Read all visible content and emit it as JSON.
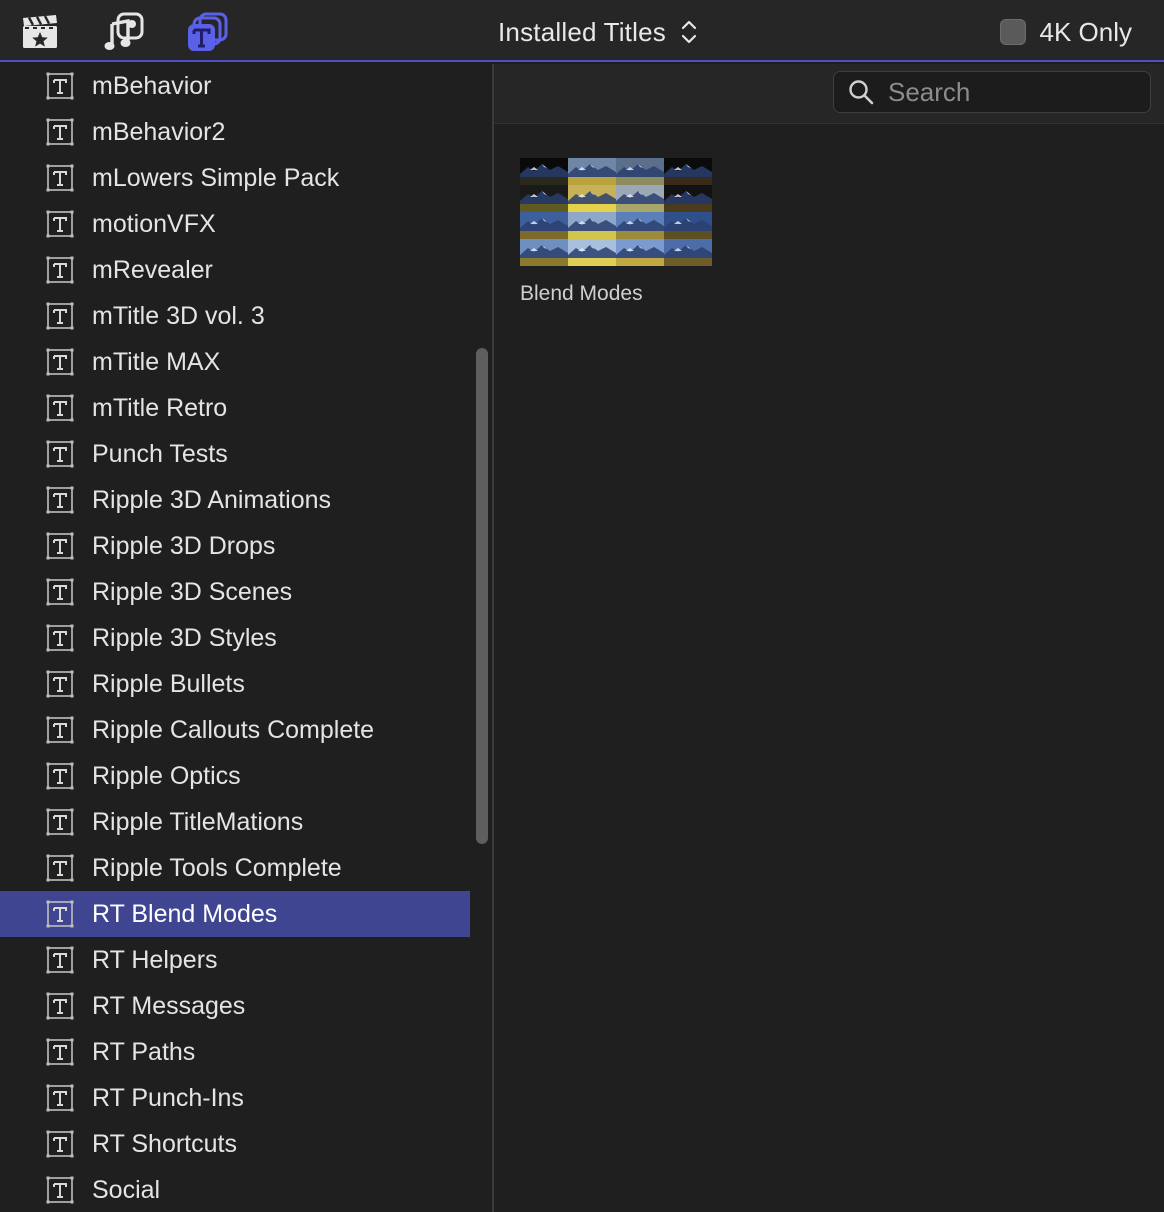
{
  "toolbar": {
    "icons": [
      "clapboard-star-icon",
      "music-photo-icon",
      "titles-icon"
    ],
    "browser_title": "Installed Titles",
    "filter_label": "4K Only",
    "filter_checked": false
  },
  "sidebar": {
    "items": [
      {
        "label": "mBehavior"
      },
      {
        "label": "mBehavior2"
      },
      {
        "label": "mLowers Simple Pack"
      },
      {
        "label": "motionVFX"
      },
      {
        "label": "mRevealer"
      },
      {
        "label": "mTitle 3D vol. 3"
      },
      {
        "label": "mTitle MAX"
      },
      {
        "label": "mTitle Retro"
      },
      {
        "label": "Punch Tests"
      },
      {
        "label": "Ripple 3D Animations"
      },
      {
        "label": "Ripple 3D Drops"
      },
      {
        "label": "Ripple 3D Scenes"
      },
      {
        "label": "Ripple 3D Styles"
      },
      {
        "label": "Ripple Bullets"
      },
      {
        "label": "Ripple Callouts Complete"
      },
      {
        "label": "Ripple Optics"
      },
      {
        "label": "Ripple TitleMations"
      },
      {
        "label": "Ripple Tools Complete"
      },
      {
        "label": "RT Blend Modes",
        "selected": true
      },
      {
        "label": "RT Helpers"
      },
      {
        "label": "RT Messages"
      },
      {
        "label": "RT Paths"
      },
      {
        "label": "RT Punch-Ins"
      },
      {
        "label": "RT Shortcuts"
      },
      {
        "label": "Social"
      }
    ]
  },
  "search": {
    "placeholder": "Search",
    "value": ""
  },
  "browser": {
    "items": [
      {
        "label": "Blend Modes"
      }
    ]
  },
  "colors": {
    "accent": "#4b4fc8",
    "selection": "#3f4590"
  }
}
